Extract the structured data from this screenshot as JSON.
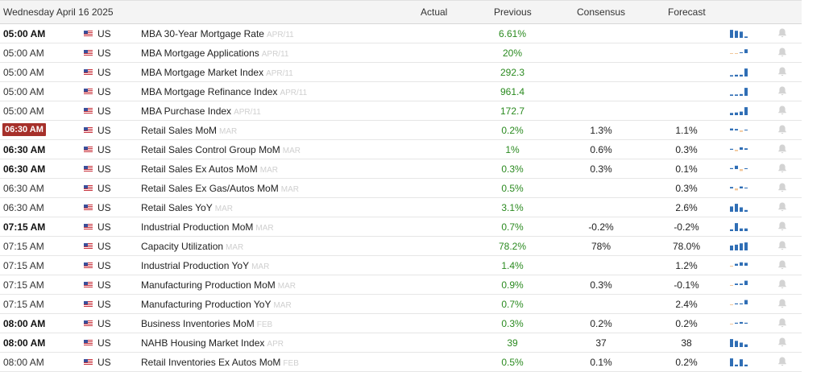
{
  "header": {
    "date": "Wednesday April 16 2025",
    "actual": "Actual",
    "previous": "Previous",
    "consensus": "Consensus",
    "forecast": "Forecast"
  },
  "colors": {
    "positive": "#2a8a1f",
    "spark_blue": "#2f6eb5",
    "spark_orange": "#f2c79a",
    "alert_red": "#a6302a"
  },
  "rows": [
    {
      "time": "05:00 AM",
      "style": "bold",
      "country": "US",
      "event": "MBA 30-Year Mortgage Rate",
      "ref": "APR/11",
      "previous": "6.61%",
      "consensus": "",
      "forecast": "",
      "spark": [
        0.9,
        0.8,
        0.7,
        0.15
      ]
    },
    {
      "time": "05:00 AM",
      "style": "",
      "country": "US",
      "event": "MBA Mortgage Applications",
      "ref": "APR/11",
      "previous": "20%",
      "consensus": "",
      "forecast": "",
      "spark": [
        -0.1,
        -0.1,
        0.1,
        0.8
      ]
    },
    {
      "time": "05:00 AM",
      "style": "",
      "country": "US",
      "event": "MBA Mortgage Market Index",
      "ref": "APR/11",
      "previous": "292.3",
      "consensus": "",
      "forecast": "",
      "spark": [
        0.15,
        0.2,
        0.2,
        0.9
      ]
    },
    {
      "time": "05:00 AM",
      "style": "",
      "country": "US",
      "event": "MBA Mortgage Refinance Index",
      "ref": "APR/11",
      "previous": "961.4",
      "consensus": "",
      "forecast": "",
      "spark": [
        0.15,
        0.15,
        0.2,
        0.9
      ]
    },
    {
      "time": "05:00 AM",
      "style": "",
      "country": "US",
      "event": "MBA Purchase Index",
      "ref": "APR/11",
      "previous": "172.7",
      "consensus": "",
      "forecast": "",
      "spark": [
        0.25,
        0.3,
        0.4,
        0.9
      ]
    },
    {
      "time": "06:30 AM",
      "style": "alert",
      "country": "US",
      "event": "Retail Sales MoM",
      "ref": "MAR",
      "previous": "0.2%",
      "consensus": "1.3%",
      "forecast": "1.1%",
      "spark": [
        0.4,
        0.3,
        -0.3,
        0.15
      ]
    },
    {
      "time": "06:30 AM",
      "style": "bold",
      "country": "US",
      "event": "Retail Sales Control Group MoM",
      "ref": "MAR",
      "previous": "1%",
      "consensus": "0.6%",
      "forecast": "0.3%",
      "spark": [
        0.2,
        -0.3,
        0.5,
        0.3
      ]
    },
    {
      "time": "06:30 AM",
      "style": "bold",
      "country": "US",
      "event": "Retail Sales Ex Autos MoM",
      "ref": "MAR",
      "previous": "0.3%",
      "consensus": "0.3%",
      "forecast": "0.1%",
      "spark": [
        0.2,
        0.7,
        -0.4,
        0.15
      ]
    },
    {
      "time": "06:30 AM",
      "style": "",
      "country": "US",
      "event": "Retail Sales Ex Gas/Autos MoM",
      "ref": "MAR",
      "previous": "0.5%",
      "consensus": "",
      "forecast": "0.3%",
      "spark": [
        0.3,
        -0.4,
        0.4,
        0.0
      ]
    },
    {
      "time": "06:30 AM",
      "style": "",
      "country": "US",
      "event": "Retail Sales YoY",
      "ref": "MAR",
      "previous": "3.1%",
      "consensus": "",
      "forecast": "2.6%",
      "spark": [
        0.6,
        0.9,
        0.5,
        0.2
      ]
    },
    {
      "time": "07:15 AM",
      "style": "bold",
      "country": "US",
      "event": "Industrial Production MoM",
      "ref": "MAR",
      "previous": "0.7%",
      "consensus": "-0.2%",
      "forecast": "-0.2%",
      "spark": [
        0.2,
        0.9,
        0.3,
        0.3
      ]
    },
    {
      "time": "07:15 AM",
      "style": "",
      "country": "US",
      "event": "Capacity Utilization",
      "ref": "MAR",
      "previous": "78.2%",
      "consensus": "78%",
      "forecast": "78.0%",
      "spark": [
        0.55,
        0.65,
        0.8,
        0.9
      ]
    },
    {
      "time": "07:15 AM",
      "style": "",
      "country": "US",
      "event": "Industrial Production YoY",
      "ref": "MAR",
      "previous": "1.4%",
      "consensus": "",
      "forecast": "1.2%",
      "spark": [
        -0.2,
        0.4,
        0.7,
        0.6
      ]
    },
    {
      "time": "07:15 AM",
      "style": "",
      "country": "US",
      "event": "Manufacturing Production MoM",
      "ref": "MAR",
      "previous": "0.9%",
      "consensus": "0.3%",
      "forecast": "-0.1%",
      "spark": [
        -0.1,
        0.3,
        0.3,
        0.9
      ]
    },
    {
      "time": "07:15 AM",
      "style": "",
      "country": "US",
      "event": "Manufacturing Production YoY",
      "ref": "MAR",
      "previous": "0.7%",
      "consensus": "",
      "forecast": "2.4%",
      "spark": [
        -0.15,
        0.2,
        0.2,
        0.9
      ]
    },
    {
      "time": "08:00 AM",
      "style": "bold",
      "country": "US",
      "event": "Business Inventories MoM",
      "ref": "FEB",
      "previous": "0.3%",
      "consensus": "0.2%",
      "forecast": "0.2%",
      "spark": [
        -0.15,
        0.2,
        0.35,
        0.2
      ]
    },
    {
      "time": "08:00 AM",
      "style": "bold",
      "country": "US",
      "event": "NAHB Housing Market Index",
      "ref": "APR",
      "previous": "39",
      "consensus": "37",
      "forecast": "38",
      "spark": [
        0.9,
        0.7,
        0.5,
        0.3
      ]
    },
    {
      "time": "08:00 AM",
      "style": "",
      "country": "US",
      "event": "Retail Inventories Ex Autos MoM",
      "ref": "FEB",
      "previous": "0.5%",
      "consensus": "0.1%",
      "forecast": "0.2%",
      "spark": [
        0.9,
        0.2,
        0.8,
        0.2
      ]
    }
  ]
}
